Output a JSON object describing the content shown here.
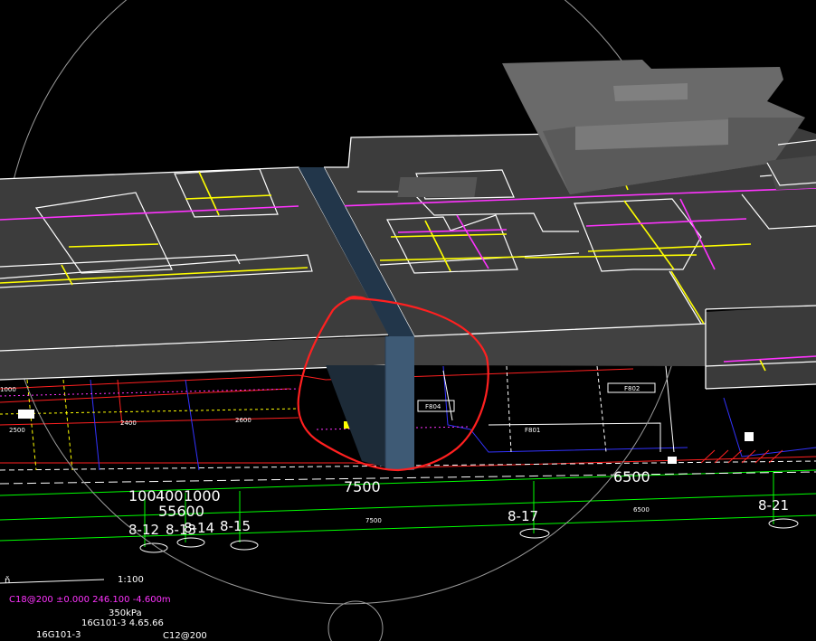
{
  "dimensions": {
    "top_row": [
      "100",
      "400",
      "1000"
    ],
    "second_row": "55600",
    "bay_7500": "7500",
    "bay_6500": "6500",
    "small_7500": "7500",
    "small_6500": "6500",
    "small_2500": "2500",
    "small_2600": "2600",
    "small_2400": "2400",
    "side_1000": "1000"
  },
  "axes": {
    "a12": "8-12",
    "a13": "8-13",
    "a14": "8-14",
    "a15": "8-15",
    "a17": "8-17",
    "a21": "8-21"
  },
  "plan_notes": {
    "title_prefix": "ň",
    "scale": "1:100",
    "line1": "C18@200 ±0.000 246.100 -4.600m",
    "line2": "350kPa",
    "line3": "16G101-3 4.65.66",
    "line4": "16G101-3",
    "line5": "C12@200",
    "tag1": "F804",
    "tag2": "F802",
    "tag3": "F801"
  },
  "colors": {
    "slab": "#3c3c3c",
    "slab_side": "#2e2e2e",
    "edge": "#ffffff",
    "rebar_yellow": "#ffff00",
    "rebar_magenta": "#ff33ff",
    "selected_column": "#3e5a75",
    "markup_red": "#ff2020",
    "plan_green": "#00ff00",
    "plan_red": "#ff2020",
    "plan_blue": "#3333ff"
  }
}
